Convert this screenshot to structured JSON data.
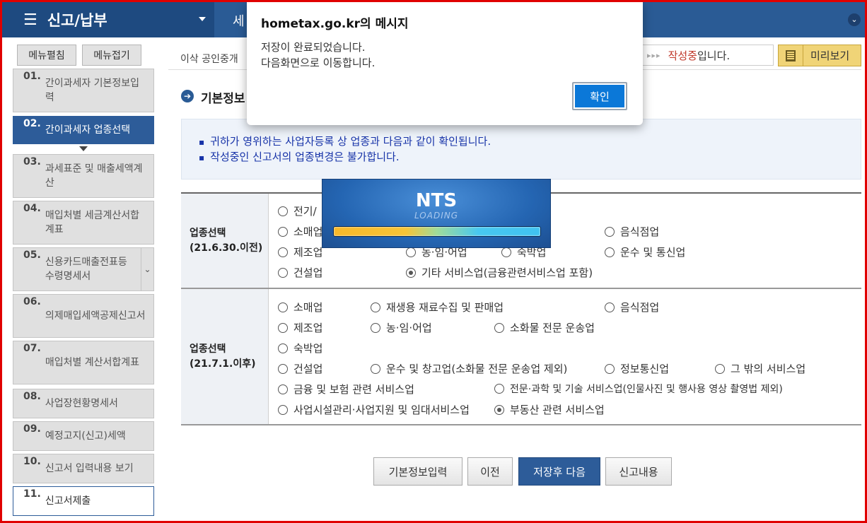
{
  "topbar": {
    "menu_title": "신고/납부",
    "crumb_text": "세"
  },
  "sidebar": {
    "expand_label": "메뉴펼침",
    "collapse_label": "메뉴접기",
    "steps": [
      {
        "num": "01.",
        "label": "간이과세자 기본정보입력"
      },
      {
        "num": "02.",
        "label": "간이과세자 업종선택"
      },
      {
        "num": "03.",
        "label": "과세표준 및 매출세액계산"
      },
      {
        "num": "04.",
        "label": "매입처별 세금계산서합계표"
      },
      {
        "num": "05.",
        "label": "신용카드매출전표등수령명세서"
      },
      {
        "num": "06.",
        "label": "의제매입세액공제신고서"
      },
      {
        "num": "07.",
        "label": "매입처별 계산서합계표"
      },
      {
        "num": "08.",
        "label": "사업장현황명세서"
      },
      {
        "num": "09.",
        "label": "예정고지(신고)세액"
      },
      {
        "num": "10.",
        "label": "신고서 입력내용 보기"
      },
      {
        "num": "11.",
        "label": "신고서제출"
      }
    ]
  },
  "header": {
    "address": "이삭 공인중개",
    "status_prefix": "작성중",
    "status_suffix": "입니다.",
    "preview_label": "미리보기"
  },
  "section": {
    "title": "기본정보"
  },
  "notice": {
    "line1": "귀하가 영위하는 사업자등록 상 업종과 다음과 같이 확인됩니다.",
    "line2": "작성중인 신고서의 업종변경은 불가합니다."
  },
  "table": {
    "before": {
      "header_line1": "업종선택",
      "header_line2": "(21.6.30.이전)",
      "options": [
        "전기/",
        "소매업",
        "음식점업",
        "제조업",
        "농·임·어업",
        "숙박업",
        "운수 및 통신업",
        "건설업",
        "기타 서비스업(금융관련서비스업 포함)"
      ],
      "selected": "기타 서비스업(금융관련서비스업 포함)"
    },
    "after": {
      "header_line1": "업종선택",
      "header_line2": "(21.7.1.이후)",
      "options": [
        "소매업",
        "재생용 재료수집 및 판매업",
        "음식점업",
        "제조업",
        "농·임·어업",
        "소화물 전문 운송업",
        "숙박업",
        "건설업",
        "운수 및 창고업(소화물 전문 운송업 제외)",
        "정보통신업",
        "그 밖의 서비스업",
        "금융 및 보험 관련 서비스업",
        "전문·과학 및 기술 서비스업(인물사진 및 행사용 영상 촬영법 제외)",
        "사업시설관리·사업지원 및 임대서비스업",
        "부동산 관련 서비스업"
      ],
      "selected": "부동산 관련 서비스업"
    }
  },
  "buttons": {
    "basic_info": "기본정보입력",
    "prev": "이전",
    "save_next": "저장후 다음",
    "report_content": "신고내용"
  },
  "loading": {
    "title": "NTS",
    "subtitle": "LOADING"
  },
  "dialog": {
    "title": "hometax.go.kr의 메시지",
    "message_line1": "저장이 완료되었습니다.",
    "message_line2": "다음화면으로 이동합니다.",
    "ok_label": "확인"
  },
  "colors": {
    "brand_blue": "#2d5c99",
    "notice_text": "#1733a8",
    "status_red": "#c0392b",
    "dialog_button": "#0b78d8"
  }
}
